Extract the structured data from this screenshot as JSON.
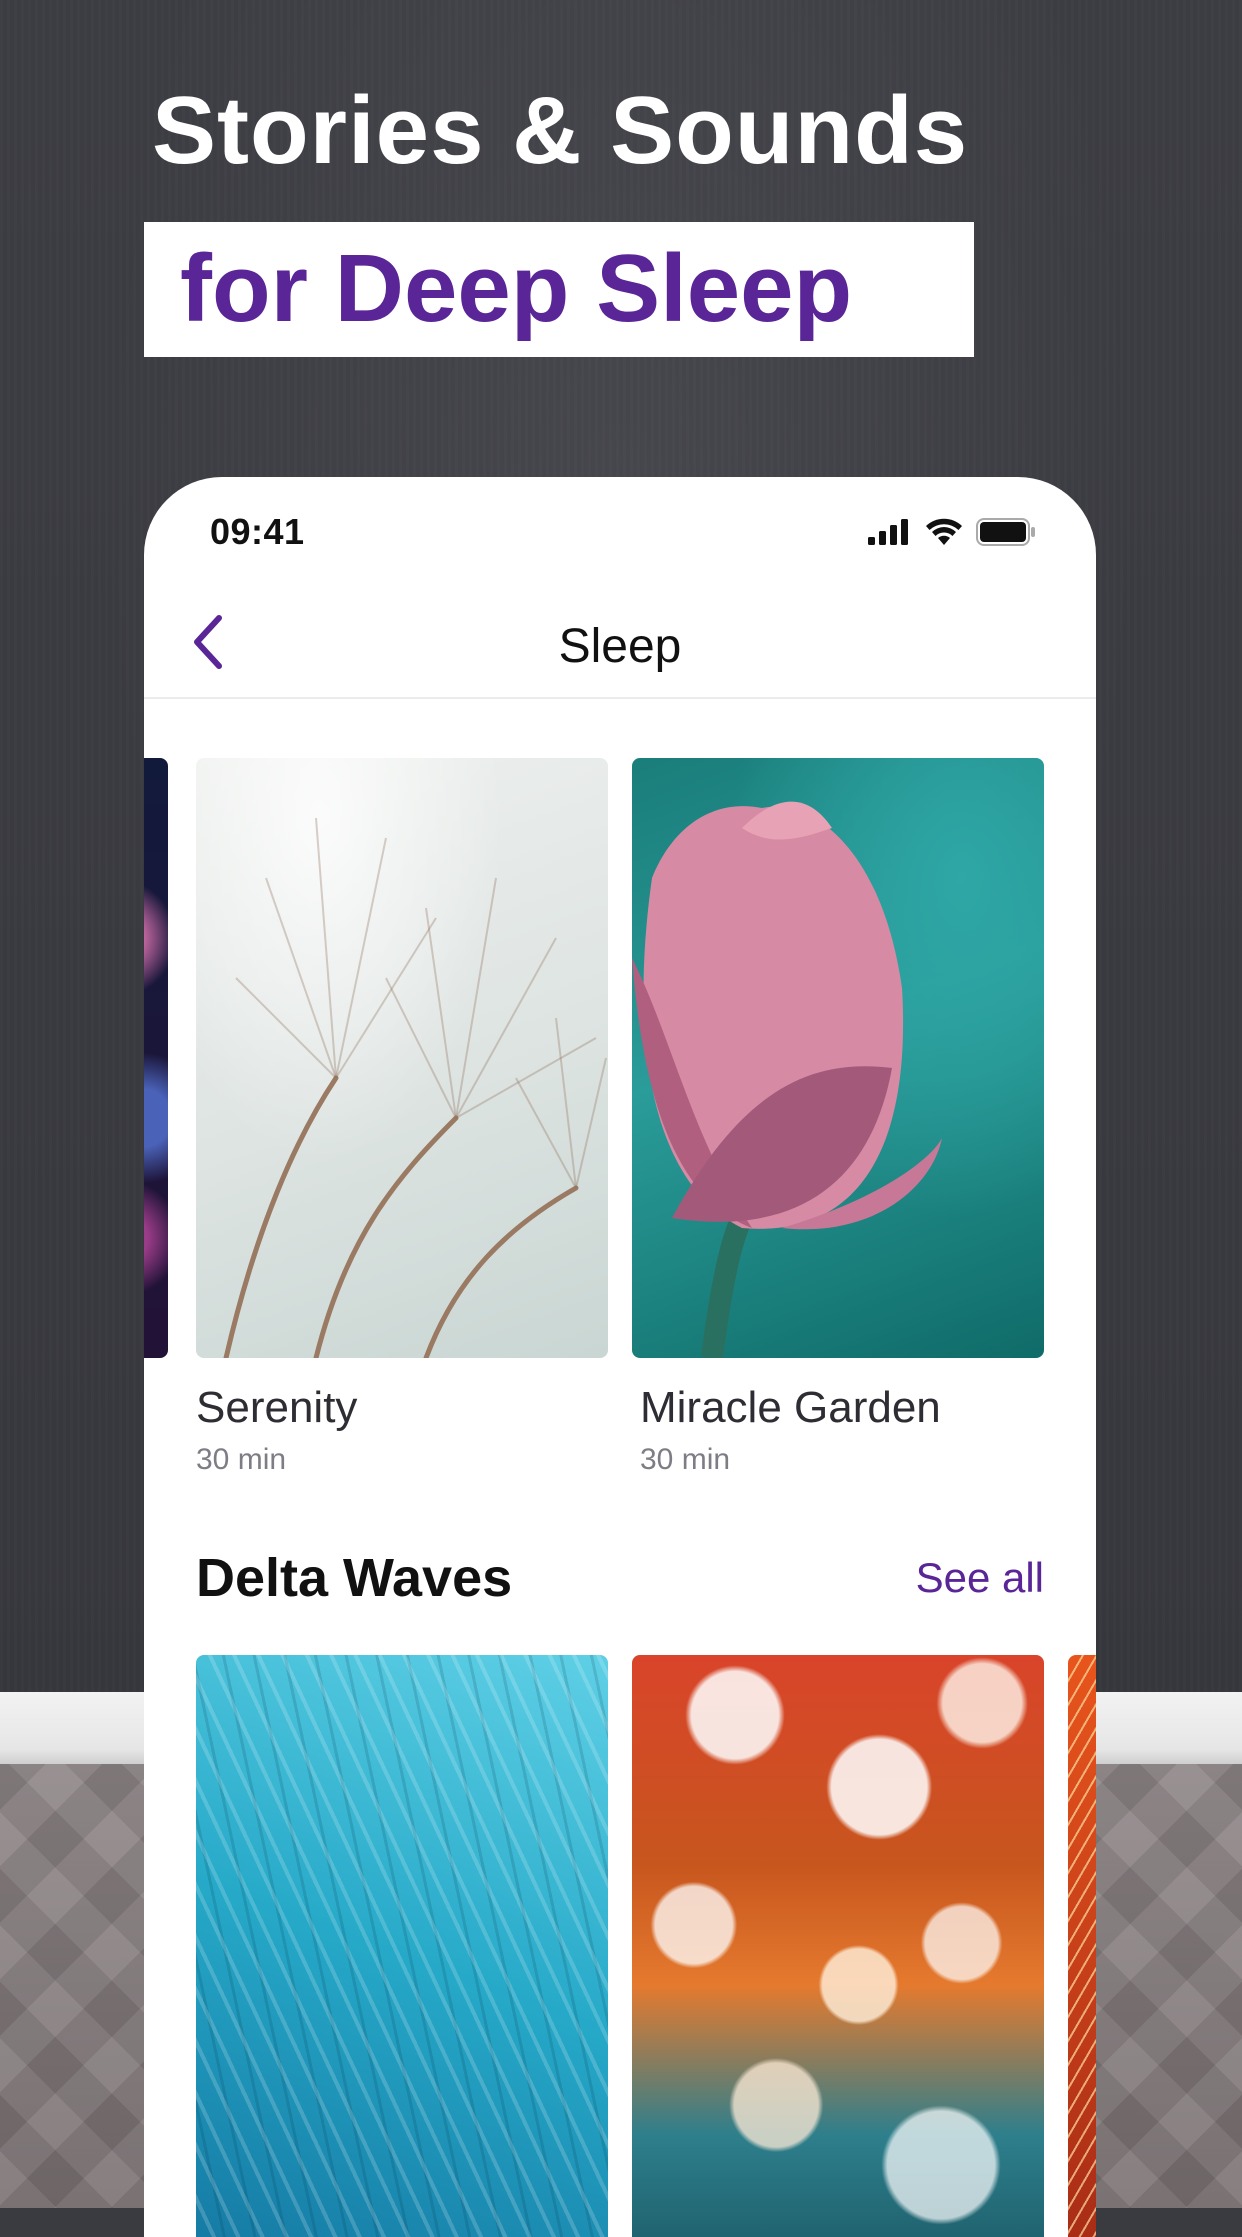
{
  "headline": {
    "line1": "Stories & Sounds",
    "line2": "for Deep Sleep"
  },
  "colors": {
    "accent": "#5a2597",
    "backdrop": "#3a3b41"
  },
  "status_bar": {
    "time": "09:41",
    "icons": [
      "signal-icon",
      "wifi-icon",
      "battery-icon"
    ]
  },
  "nav": {
    "back_icon": "chevron-left-icon",
    "title": "Sleep"
  },
  "top_row": {
    "cards": [
      {
        "title": "Serenity",
        "duration": "30 min",
        "image": "dandelion-photo"
      },
      {
        "title": "Miracle Garden",
        "duration": "30 min",
        "image": "lotus-photo"
      }
    ]
  },
  "delta_section": {
    "title": "Delta Waves",
    "see_all_label": "See all"
  }
}
